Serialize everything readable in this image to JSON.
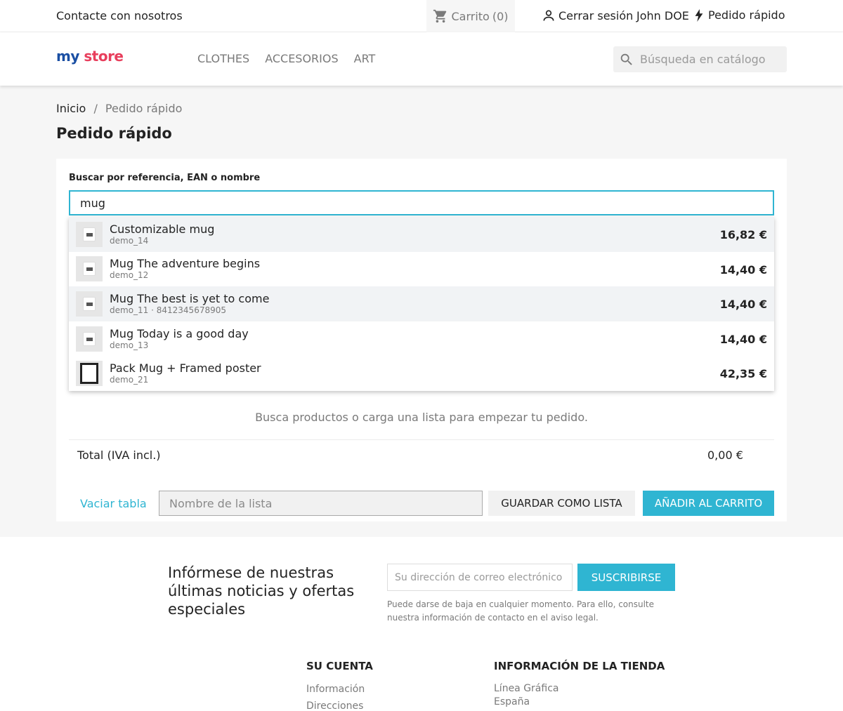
{
  "topbar": {
    "contact": "Contacte con nosotros",
    "cart_label": "Carrito",
    "cart_count": "(0)",
    "logout": "Cerrar sesión",
    "username": "John DOE",
    "quick_order": "Pedido rápido"
  },
  "header": {
    "logo_left": "my",
    "logo_right": "store",
    "nav": [
      "CLOTHES",
      "ACCESORIOS",
      "ART"
    ],
    "search_placeholder": "Búsqueda en catálogo"
  },
  "breadcrumb": {
    "home": "Inicio",
    "separator": "/",
    "current": "Pedido rápido"
  },
  "page_title": "Pedido rápido",
  "quick_order": {
    "search_label": "Buscar por referencia, EAN o nombre",
    "search_value": "mug",
    "results": [
      {
        "name": "Customizable mug",
        "ref": "demo_14",
        "price": "16,82 €",
        "thumb": "mug-icon"
      },
      {
        "name": "Mug The adventure begins",
        "ref": "demo_12",
        "price": "14,40 €",
        "thumb": "mug-icon"
      },
      {
        "name": "Mug The best is yet to come",
        "ref": "demo_11 · 8412345678905",
        "price": "14,40 €",
        "thumb": "mug-icon"
      },
      {
        "name": "Mug Today is a good day",
        "ref": "demo_13",
        "price": "14,40 €",
        "thumb": "mug-icon"
      },
      {
        "name": "Pack Mug + Framed poster",
        "ref": "demo_21",
        "price": "42,35 €",
        "thumb": "frame-icon"
      }
    ],
    "empty_message": "Busca productos o carga una lista para empezar tu pedido.",
    "total_label": "Total (IVA incl.)",
    "total_value": "0,00 €",
    "clear_table": "Vaciar tabla",
    "list_name_placeholder": "Nombre de la lista",
    "save_list": "Guardar como lista",
    "add_to_cart": "Añadir al carrito"
  },
  "footer": {
    "newsletter_title": "Infórmese de nuestras últimas noticias y ofertas especiales",
    "email_placeholder": "Su dirección de correo electrónico",
    "subscribe": "Suscribirse",
    "note": "Puede darse de baja en cualquier momento. Para ello, consulte nuestra información de contacto en el aviso legal.",
    "account_title": "Su cuenta",
    "account_links": [
      "Información",
      "Direcciones"
    ],
    "store_title": "Información de la tienda",
    "store_lines": [
      "Línea Gráfica",
      "España"
    ]
  },
  "colors": {
    "accent": "#2fb5d2",
    "logo_blue": "#1a4fa3",
    "logo_red": "#e83e5c"
  }
}
